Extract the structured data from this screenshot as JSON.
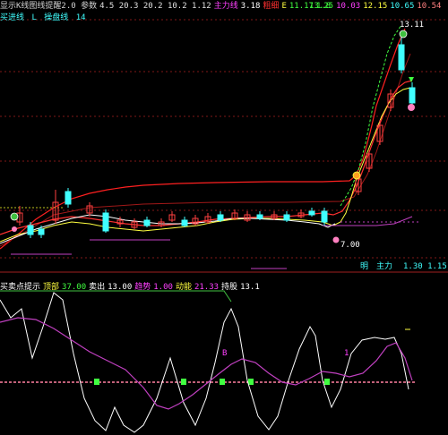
{
  "main_header": {
    "items": [
      {
        "text": "显示K线图线提醒2.0 参数",
        "color": "#d0d0d0"
      },
      {
        "text": "4.5 20.3 20.2 10.2 1.12",
        "color": "#e0e0e0"
      },
      {
        "text": "主力线",
        "color": "#ff40ff"
      },
      {
        "text": "3.18",
        "color": "#ffffff"
      },
      {
        "text": "粗细",
        "color": "#ff3030"
      },
      {
        "text": "E",
        "color": "#ffff40"
      },
      {
        "text": "11.17",
        "color": "#40ff40"
      },
      {
        "text": "1.8",
        "color": "#40ff40"
      }
    ],
    "right": [
      {
        "text": "13.25",
        "color": "#40ff40"
      },
      {
        "text": "10.03",
        "color": "#ff40ff"
      },
      {
        "text": "12.15",
        "color": "#ffff40"
      },
      {
        "text": "10.65",
        "color": "#40ffff"
      },
      {
        "text": "10.54",
        "color": "#ff8080"
      }
    ]
  },
  "main_header2": {
    "label": "买进线",
    "value1": "L",
    "label2": "操盘线",
    "value2": "14"
  },
  "price_labels": {
    "high": "13.11",
    "low": "7.00"
  },
  "indicator_header": {
    "items": [
      {
        "text": "买卖点提示",
        "color": "#ffffff"
      },
      {
        "text": "顶部",
        "color": "#ffff40"
      },
      {
        "text": "37.00",
        "color": "#40ff40"
      },
      {
        "text": "卖出",
        "color": "#ffffff"
      },
      {
        "text": "13.00",
        "color": "#ffffff"
      },
      {
        "text": "趋势",
        "color": "#ff40ff"
      },
      {
        "text": "1.00",
        "color": "#ff40ff"
      },
      {
        "text": "动能",
        "color": "#ffff40"
      },
      {
        "text": "21.33",
        "color": "#ff40ff"
      },
      {
        "text": "持股",
        "color": "#ffffff"
      },
      {
        "text": "13.1",
        "color": "#ffffff"
      }
    ]
  },
  "volume_label": {
    "prefix": "明",
    "text": "主力",
    "value": "1.30 1.15"
  },
  "colors": {
    "bg": "#000000",
    "ma_red": "#ff2020",
    "ma_yellow": "#ffff40",
    "ma_white": "#ffffff",
    "up_candle": "#ff4040",
    "down_candle": "#40ffff",
    "magenta": "#c040c0",
    "pink_line": "#ff80c0",
    "green_line": "#40ff40"
  }
}
